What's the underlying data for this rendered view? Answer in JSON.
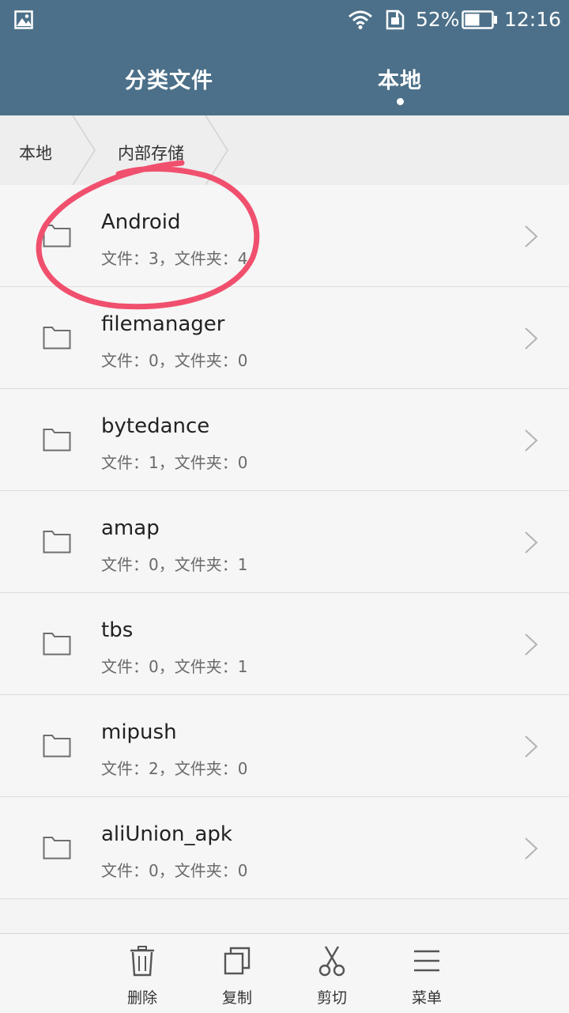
{
  "status_bar": {
    "battery_percent": "52%",
    "time": "12:16",
    "icons": [
      "image-notification-icon",
      "wifi-icon",
      "sim-card-icon",
      "battery-icon"
    ]
  },
  "tabs": [
    {
      "label": "分类文件",
      "active": false
    },
    {
      "label": "本地",
      "active": true
    }
  ],
  "breadcrumb": [
    "本地",
    "内部存储"
  ],
  "files": [
    {
      "name": "Android",
      "meta": "文件：3，文件夹：4"
    },
    {
      "name": "filemanager",
      "meta": "文件：0，文件夹：0"
    },
    {
      "name": "bytedance",
      "meta": "文件：1，文件夹：0"
    },
    {
      "name": "amap",
      "meta": "文件：0，文件夹：1"
    },
    {
      "name": "tbs",
      "meta": "文件：0，文件夹：1"
    },
    {
      "name": "mipush",
      "meta": "文件：2，文件夹：0"
    },
    {
      "name": "aliUnion_apk",
      "meta": "文件：0，文件夹：0"
    }
  ],
  "toolbar": {
    "delete_label": "删除",
    "copy_label": "复制",
    "cut_label": "剪切",
    "menu_label": "菜单"
  },
  "colors": {
    "header_bg": "#4c7089",
    "annotation": "#f0506e"
  }
}
